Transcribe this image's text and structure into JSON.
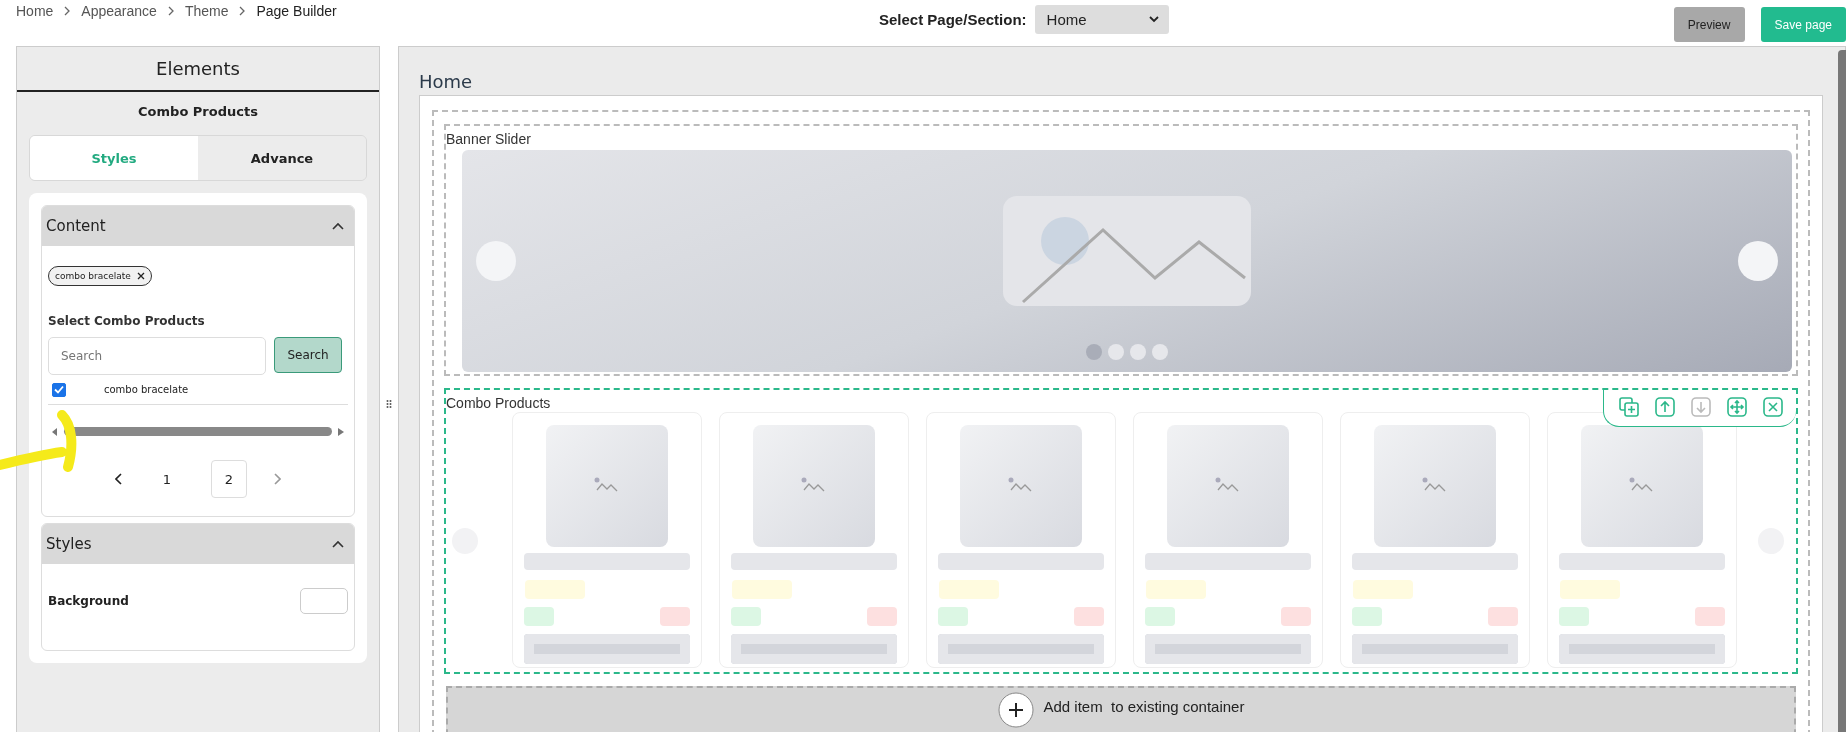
{
  "breadcrumb": [
    {
      "label": "Home",
      "current": false
    },
    {
      "label": "Appearance",
      "current": false
    },
    {
      "label": "Theme",
      "current": false
    },
    {
      "label": "Page Builder",
      "current": true
    }
  ],
  "page_select": {
    "label": "Select Page/Section:",
    "value": "Home"
  },
  "buttons": [
    {
      "label": "Preview",
      "kind": "secondary"
    },
    {
      "label": "Save page",
      "kind": "primary"
    }
  ],
  "elements_panel": {
    "title": "Elements",
    "subtitle": "Combo Products",
    "tabs": [
      {
        "label": "Styles",
        "selected": true
      },
      {
        "label": "Advance",
        "selected": false
      }
    ],
    "sections": [
      {
        "kind": "content",
        "title": "Content",
        "expanded": true,
        "tags": [
          "combo bracelate"
        ],
        "select_label": "Select Combo Products",
        "search": {
          "placeholder": "Search",
          "button": "Search"
        },
        "results": [
          {
            "label": "combo bracelate",
            "checked": true
          }
        ],
        "pages": [
          {
            "label": "1",
            "selected": false
          },
          {
            "label": "2",
            "selected": true
          }
        ]
      },
      {
        "kind": "styles",
        "title": "Styles",
        "expanded": true,
        "fields": [
          {
            "label": "Background"
          }
        ]
      }
    ]
  },
  "canvas": {
    "title": "Home",
    "sections": [
      {
        "kind": "banner",
        "label": "Banner Slider",
        "selected": false
      },
      {
        "kind": "products",
        "label": "Combo Products",
        "selected": true,
        "cards": [
          {
            "kind": "placeholder"
          },
          {
            "kind": "placeholder"
          },
          {
            "kind": "placeholder"
          },
          {
            "kind": "placeholder"
          },
          {
            "kind": "placeholder"
          },
          {
            "kind": "placeholder"
          }
        ]
      }
    ],
    "add_bar": {
      "label": "Add item  to existing container"
    }
  }
}
